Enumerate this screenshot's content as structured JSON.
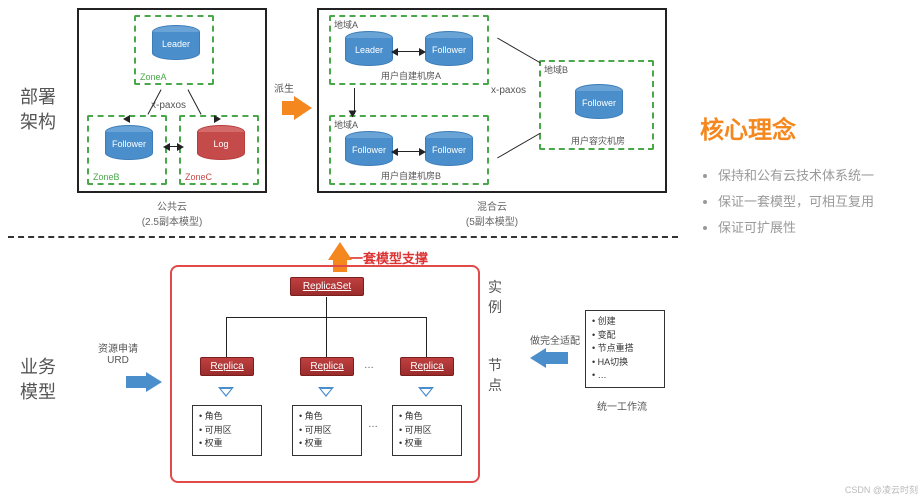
{
  "labels": {
    "deploy_arch_1": "部署",
    "deploy_arch_2": "架构",
    "biz_model_1": "业务",
    "biz_model_2": "模型",
    "derive": "派生",
    "xpaxos": "x-paxos",
    "public_cloud": "公共云",
    "public_cloud_sub": "(2.5副本模型)",
    "hybrid_cloud": "混合云",
    "hybrid_cloud_sub": "(5副本模型)",
    "regionA": "地域A",
    "regionB": "地域B",
    "user_dc_a": "用户自建机房A",
    "user_dc_b": "用户自建机房B",
    "user_dr_dc": "用户容灾机房",
    "model_support": "一套模型支撑",
    "resource_req": "资源申请",
    "urd": "URD",
    "instance": "实例",
    "node_lbl": "节点",
    "full_adapt": "做完全适配",
    "workflow": "统一工作流",
    "ellipsis": "…",
    "watermark": "CSDN @凌云时刻"
  },
  "cylinders": {
    "leader": "Leader",
    "follower": "Follower",
    "log": "Log"
  },
  "zones": {
    "zoneA": "ZoneA",
    "zoneB": "ZoneB",
    "zoneC": "ZoneC"
  },
  "replicas": {
    "replicaset": "ReplicaSet",
    "replica": "Replica"
  },
  "replica_attrs": {
    "a1": "角色",
    "a2": "可用区",
    "a3": "权重"
  },
  "workflow_items": {
    "w1": "创建",
    "w2": "变配",
    "w3": "节点重搭",
    "w4": "HA切换",
    "w5": "…"
  },
  "right": {
    "title": "核心理念",
    "b1": "保持和公有云技术体系统一",
    "b2": "保证一套模型，可相互复用",
    "b3": "保证可扩展性"
  }
}
